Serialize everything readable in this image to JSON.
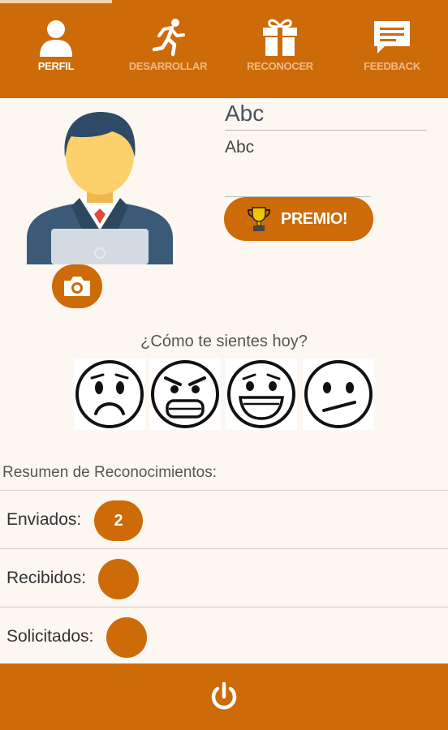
{
  "nav": {
    "tabs": [
      {
        "label": "PERFIL",
        "icon": "person-icon",
        "active": true
      },
      {
        "label": "DESARROLLAR",
        "icon": "running-person-icon",
        "active": false
      },
      {
        "label": "RECONOCER",
        "icon": "gift-icon",
        "active": false
      },
      {
        "label": "FEEDBACK",
        "icon": "chat-bubble-icon",
        "active": false
      }
    ]
  },
  "profile": {
    "name": "Abc",
    "subtitle": "Abc",
    "avatar_icon": "businessman-avatar-icon",
    "camera_icon": "camera-icon",
    "premio_label": "PREMIO!",
    "premio_icon": "trophy-icon"
  },
  "mood": {
    "question": "¿Cómo te sientes hoy?",
    "faces": [
      "sad-face-icon",
      "angry-face-icon",
      "happy-face-icon",
      "neutral-face-icon"
    ]
  },
  "summary": {
    "title": "Resumen de Reconocimientos:",
    "rows": [
      {
        "label": "Enviados:",
        "count": "2"
      },
      {
        "label": "Recibidos:",
        "count": ""
      },
      {
        "label": "Solicitados:",
        "count": ""
      }
    ]
  },
  "footer": {
    "icon": "power-icon"
  },
  "colors": {
    "accent": "#cc6b07",
    "background": "#fdf7f1"
  }
}
